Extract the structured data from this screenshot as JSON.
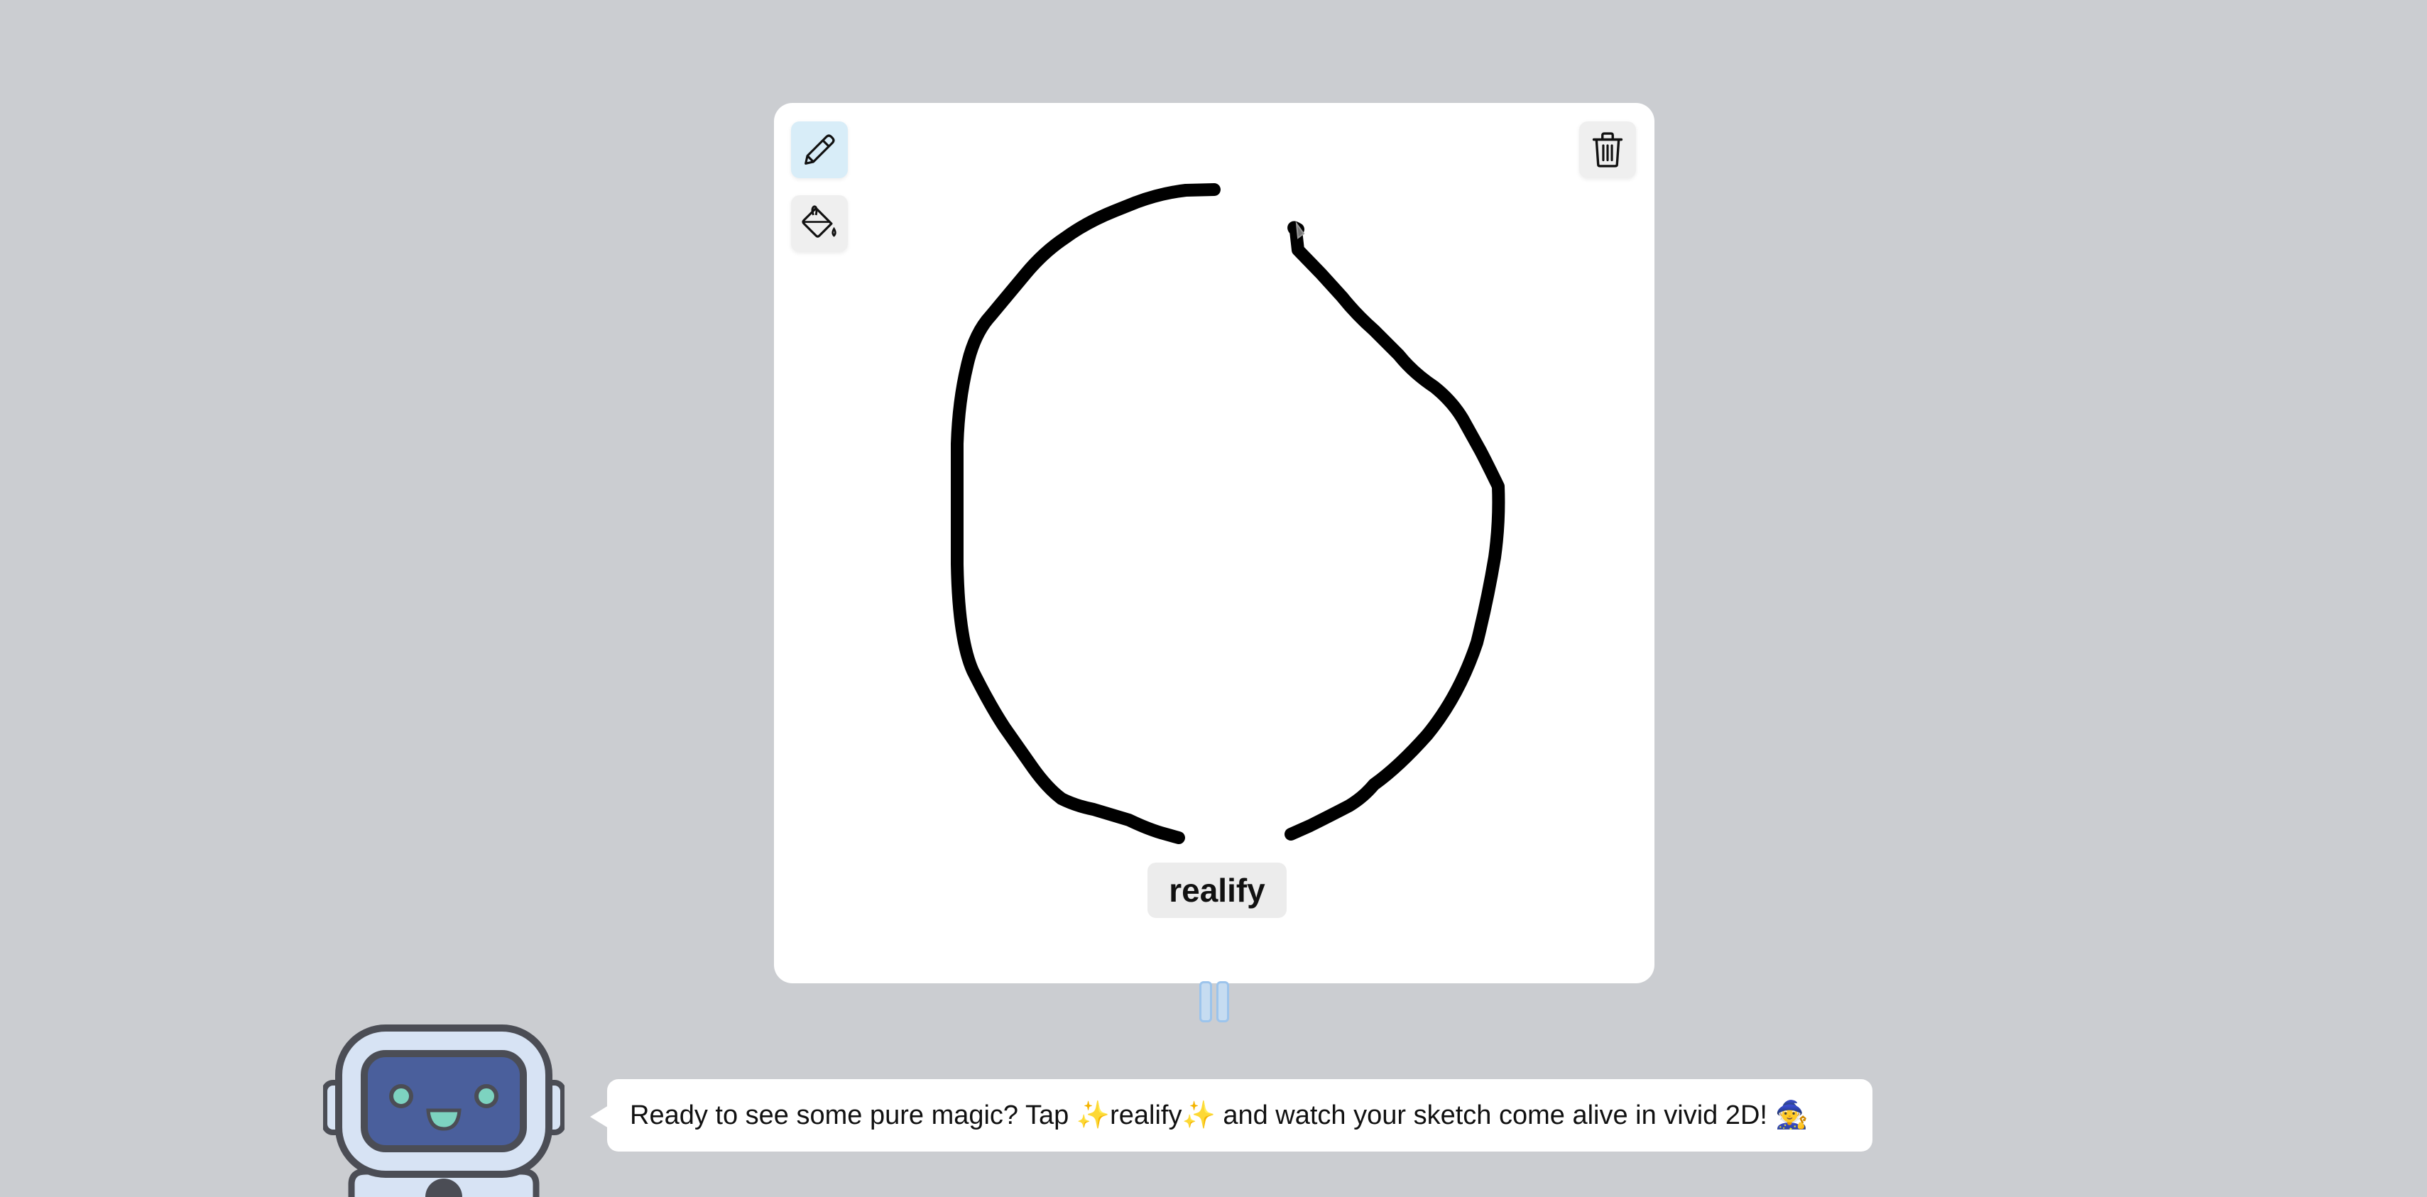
{
  "toolbar": {
    "pencil_icon": "pencil-icon",
    "fill_icon": "paint-bucket-icon",
    "trash_icon": "trash-icon"
  },
  "canvas": {
    "stroke_color": "#000000",
    "background": "#ffffff"
  },
  "actions": {
    "realify_label": "realify"
  },
  "playback": {
    "pause_icon": "pause-icon"
  },
  "assistant": {
    "message": "Ready to see some pure magic? Tap ✨realify✨ and watch your sketch come alive in vivid 2D! 🧙"
  },
  "colors": {
    "page_background": "#cbcdd1",
    "pencil_active": "#d8edf8",
    "button_bg": "#ececec",
    "robot_body": "#d7e3f4",
    "robot_screen": "#4a5f9c",
    "robot_eyes": "#7dd3c0"
  }
}
